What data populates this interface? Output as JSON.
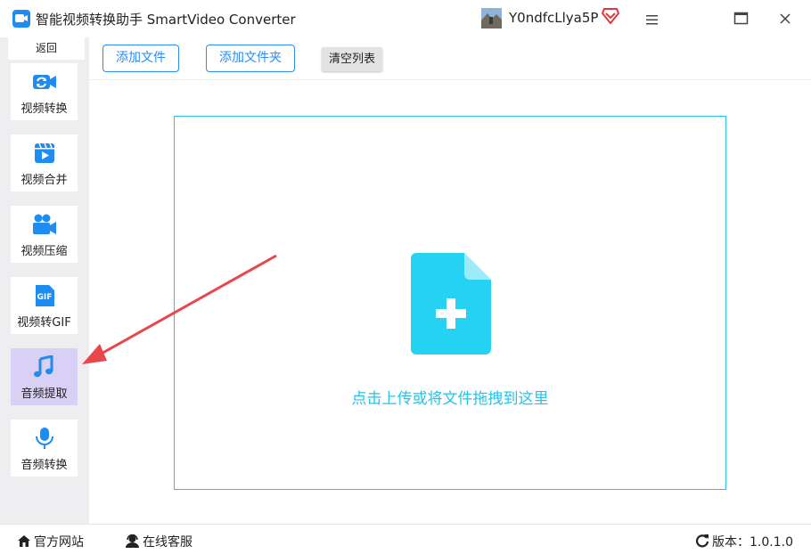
{
  "titlebar": {
    "app_title": "智能视频转换助手 SmartVideo Converter",
    "username": "Y0ndfcLlya5P",
    "icons": [
      "app-logo-icon",
      "avatar",
      "vip-diamond-icon",
      "menu-icon",
      "maximize-icon",
      "close-icon"
    ]
  },
  "sidebar": {
    "back_label": "返回",
    "items": [
      {
        "label": "视频转换",
        "icon": "video-convert-icon",
        "active": false
      },
      {
        "label": "视频合并",
        "icon": "video-merge-icon",
        "active": false
      },
      {
        "label": "视频压缩",
        "icon": "video-compress-icon",
        "active": false
      },
      {
        "label": "视频转GIF",
        "icon": "gif-icon",
        "active": false
      },
      {
        "label": "音频提取",
        "icon": "music-note-icon",
        "active": true
      },
      {
        "label": "音频转换",
        "icon": "microphone-icon",
        "active": false
      }
    ]
  },
  "toolbar": {
    "add_file": "添加文件",
    "add_folder": "添加文件夹",
    "clear_list": "清空列表"
  },
  "dropzone": {
    "text": "点击上传或将文件拖拽到这里",
    "icon": "file-add-icon"
  },
  "footer": {
    "website": "官方网站",
    "support": "在线客服",
    "version": "版本：1.0.1.0"
  },
  "colors": {
    "accent_blue": "#2d8cf0",
    "icon_blue": "#1e8cf0",
    "cyan": "#26c3e6",
    "active_item_bg": "#d9d0f5",
    "sidebar_bg": "#eeeef0",
    "annotation_red": "#e8474b"
  }
}
